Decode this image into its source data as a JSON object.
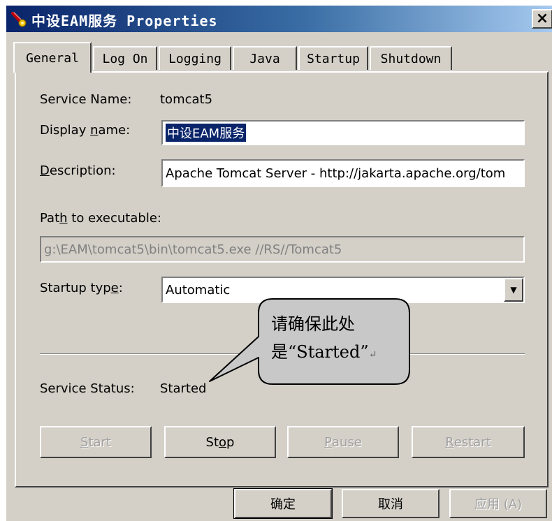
{
  "window": {
    "title": "中设EAM服务 Properties",
    "close_glyph": "×"
  },
  "tabs": [
    {
      "label": "General",
      "active": true
    },
    {
      "label": "Log On",
      "active": false
    },
    {
      "label": "Logging",
      "active": false
    },
    {
      "label": "Java",
      "active": false
    },
    {
      "label": "Startup",
      "active": false
    },
    {
      "label": "Shutdown",
      "active": false
    }
  ],
  "general": {
    "service_name_label": "Service Name:",
    "service_name_value": "tomcat5",
    "display_name_label_pre": "Display ",
    "display_name_label_u": "n",
    "display_name_label_post": "ame:",
    "display_name_value": "中设EAM服务",
    "description_label_u": "D",
    "description_label_post": "escription:",
    "description_value": "Apache Tomcat Server - http://jakarta.apache.org/tom",
    "path_label_pre": "Pat",
    "path_label_u": "h",
    "path_label_post": " to executable:",
    "path_value": "g:\\EAM\\tomcat5\\bin\\tomcat5.exe //RS//Tomcat5",
    "startup_label_pre": "Startup typ",
    "startup_label_u": "e",
    "startup_label_post": ":",
    "startup_value": "Automatic",
    "status_label": "Service Status:",
    "status_value": "Started"
  },
  "service_buttons": {
    "start": {
      "u": "S",
      "rest": "tart",
      "enabled": false
    },
    "stop": {
      "pre": "St",
      "u": "o",
      "rest": "p",
      "enabled": true
    },
    "pause": {
      "u": "P",
      "rest": "ause",
      "enabled": false
    },
    "restart": {
      "u": "R",
      "rest": "estart",
      "enabled": false
    }
  },
  "dialog_buttons": {
    "ok": "确定",
    "cancel": "取消",
    "apply": "应用 (A)"
  },
  "callout": {
    "line1": "请确保此处",
    "line2": "是“Started”",
    "return_mark": "↵"
  },
  "colors": {
    "titlebar_start": "#0a246a",
    "titlebar_end": "#a6caf0",
    "dialog_face": "#d4d0c8",
    "selection": "#0a246a",
    "callout_fill": "#c8c8c8"
  }
}
